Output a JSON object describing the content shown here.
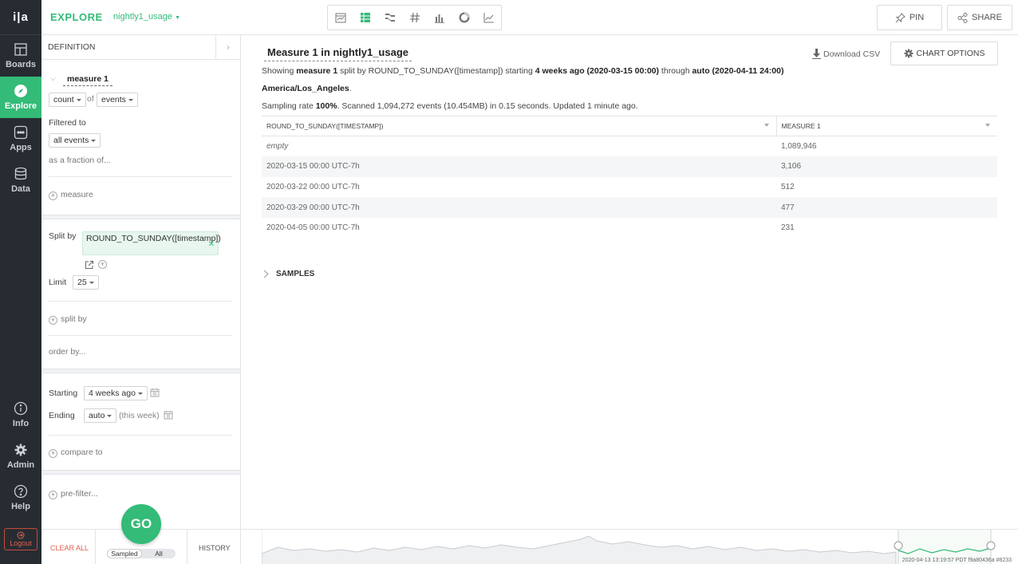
{
  "nav": {
    "logo": "i|a",
    "items": [
      {
        "icon": "boards-icon",
        "label": "Boards"
      },
      {
        "icon": "explore-icon",
        "label": "Explore"
      },
      {
        "icon": "apps-icon",
        "label": "Apps"
      },
      {
        "icon": "data-icon",
        "label": "Data"
      }
    ],
    "bottom_items": [
      {
        "icon": "info-icon",
        "label": "Info"
      },
      {
        "icon": "gear-icon",
        "label": "Admin"
      },
      {
        "icon": "help-icon",
        "label": "Help"
      }
    ],
    "logout": "Logout",
    "accent": "#33bb77",
    "background": "#272c33"
  },
  "topbar": {
    "section": "EXPLORE",
    "datasource": "nightly1_usage",
    "viz_icons": [
      "calendar-chart-icon",
      "table-icon",
      "sankey-icon",
      "number-icon",
      "bar-chart-icon",
      "donut-chart-icon",
      "line-chart-icon"
    ],
    "active_viz": "table-icon",
    "pin": "PIN",
    "share": "SHARE"
  },
  "definition": {
    "header": "DEFINITION",
    "measure_name": "measure 1",
    "aggregate": "count",
    "of_label": "of",
    "measure_target": "events",
    "filtered_to_label": "Filtered to",
    "filter_value": "all events",
    "fraction_label": "as a fraction of...",
    "add_measure": "measure",
    "split_by_label": "Split by",
    "split_value": "ROUND_TO_SUNDAY([timestamp])",
    "limit_label": "Limit",
    "limit_value": "25",
    "add_split": "split by",
    "order_by": "order by...",
    "starting_label": "Starting",
    "starting_value": "4 weeks ago",
    "ending_label": "Ending",
    "ending_value": "auto",
    "ending_note": "(this week)",
    "compare_to": "compare to",
    "pre_filter": "pre-filter..."
  },
  "bottombar": {
    "clear_all": "CLEAR ALL",
    "go": "GO",
    "toggle": {
      "left": "Sampled",
      "right": "All",
      "selected": "Sampled"
    },
    "history": "HISTORY",
    "footer": "2020-04-13 13:19:57 PDT f9a80436a #8233"
  },
  "main": {
    "title": "Measure 1 in nightly1_usage",
    "download_csv": "Download CSV",
    "chart_options": "CHART OPTIONS",
    "summary1": {
      "t1": "Showing ",
      "b1": "measure 1",
      "t2": " split by ROUND_TO_SUNDAY([timestamp]) starting ",
      "b2": "4 weeks ago (2020-03-15 00:00)",
      "t3": " through ",
      "b3": "auto (2020-04-11 24:00)"
    },
    "summary2": {
      "b1": "America/Los_Angeles",
      "t1": "."
    },
    "summary3": {
      "t1": "Sampling rate ",
      "b1": "100%",
      "t2": ". Scanned 1,094,272 events (10.454MB) in 0.15 seconds. Updated 1 minute ago."
    },
    "table": {
      "columns": [
        "ROUND_TO_SUNDAY([TIMESTAMP])",
        "MEASURE 1"
      ],
      "rows": [
        [
          "empty",
          "1,089,946"
        ],
        [
          "2020-03-15 00:00 UTC-7h",
          "3,106"
        ],
        [
          "2020-03-22 00:00 UTC-7h",
          "512"
        ],
        [
          "2020-03-29 00:00 UTC-7h",
          "477"
        ],
        [
          "2020-04-05 00:00 UTC-7h",
          "231"
        ]
      ]
    },
    "samples": "SAMPLES"
  }
}
